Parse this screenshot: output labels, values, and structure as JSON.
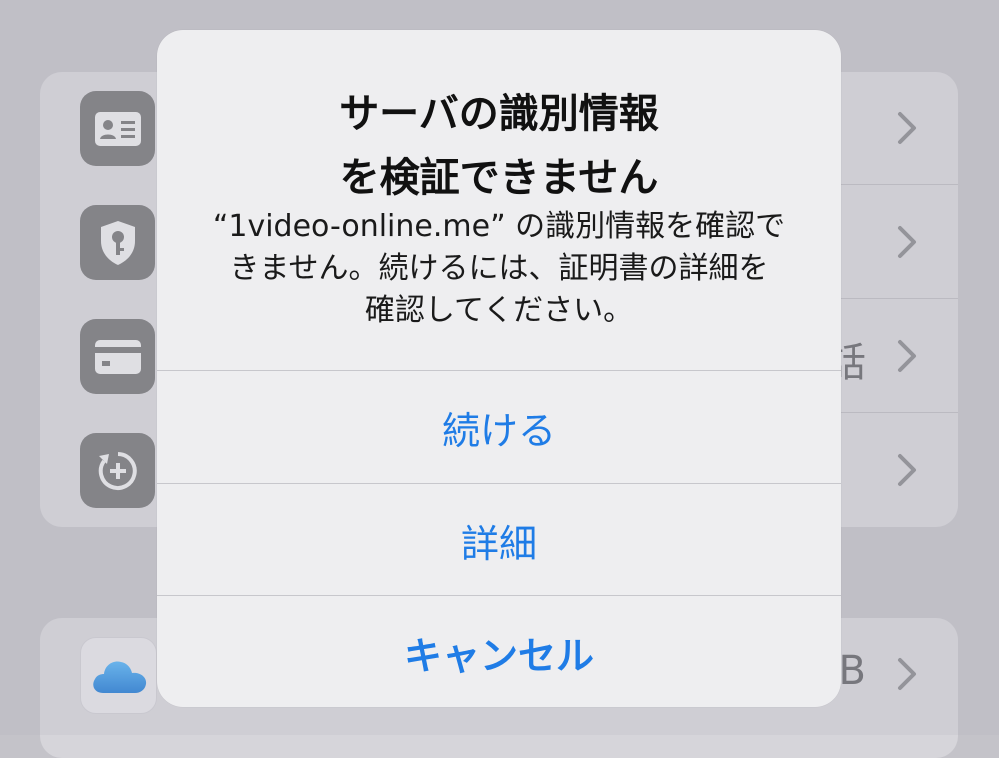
{
  "background_list": {
    "rows": [
      {
        "icon": "id-card-icon"
      },
      {
        "icon": "shield-key-icon"
      },
      {
        "icon": "credit-card-icon",
        "trailing_text": "話"
      },
      {
        "icon": "add-restore-icon"
      }
    ],
    "icloud_row": {
      "icon": "icloud-icon",
      "trailing_text": "B"
    }
  },
  "alert": {
    "title": "サーバの識別情報\nを検証できません",
    "message": "“1video-online.me” の識別情報を確認で\nきません。続けるには、証明書の詳細を\n確認してください。",
    "buttons": {
      "continue": "続ける",
      "details": "詳細",
      "cancel": "キャンセル"
    }
  },
  "colors": {
    "accent": "#1f7ce6",
    "alert_background": "#eeeef0",
    "page_background": "#c4c3c9"
  }
}
